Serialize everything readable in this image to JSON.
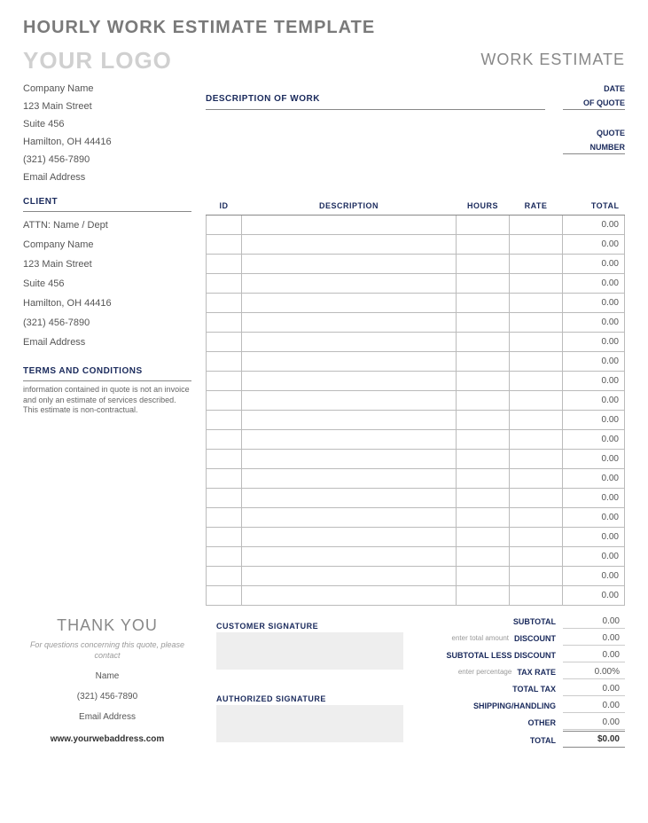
{
  "title": "HOURLY WORK ESTIMATE TEMPLATE",
  "logo": "YOUR LOGO",
  "doc_type": "WORK ESTIMATE",
  "company": {
    "name": "Company Name",
    "street": "123 Main Street",
    "suite": "Suite 456",
    "city": "Hamilton, OH  44416",
    "phone": "(321) 456-7890",
    "email": "Email Address"
  },
  "desc_of_work_label": "DESCRIPTION OF WORK",
  "meta": {
    "date_label": "DATE",
    "of_quote_label": "OF QUOTE",
    "quote_label": "QUOTE",
    "number_label": "NUMBER"
  },
  "client": {
    "header": "CLIENT",
    "attn": "ATTN: Name / Dept",
    "company": "Company Name",
    "street": "123 Main Street",
    "suite": "Suite 456",
    "city": "Hamilton, OH  44416",
    "phone": "(321) 456-7890",
    "email": "Email Address"
  },
  "terms": {
    "header": "TERMS AND CONDITIONS",
    "text": "information contained in quote is not an invoice and only an estimate of services described. This estimate is non-contractual."
  },
  "columns": {
    "id": "ID",
    "desc": "DESCRIPTION",
    "hours": "HOURS",
    "rate": "RATE",
    "total": "TOTAL"
  },
  "row_total": "0.00",
  "row_count": 20,
  "thank_you": "THANK YOU",
  "contact_note": "For questions concerning this quote, please contact",
  "contact": {
    "name": "Name",
    "phone": "(321) 456-7890",
    "email": "Email Address",
    "web": "www.yourwebaddress.com"
  },
  "sig": {
    "customer": "CUSTOMER SIGNATURE",
    "authorized": "AUTHORIZED SIGNATURE"
  },
  "totals": {
    "subtotal_label": "SUBTOTAL",
    "subtotal": "0.00",
    "discount_hint": "enter total amount",
    "discount_label": "DISCOUNT",
    "discount": "0.00",
    "less_label": "SUBTOTAL LESS DISCOUNT",
    "less": "0.00",
    "taxrate_hint": "enter percentage",
    "taxrate_label": "TAX RATE",
    "taxrate": "0.00%",
    "totaltax_label": "TOTAL TAX",
    "totaltax": "0.00",
    "shipping_label": "SHIPPING/HANDLING",
    "shipping": "0.00",
    "other_label": "OTHER",
    "other": "0.00",
    "total_label": "TOTAL",
    "total": "$0.00"
  }
}
